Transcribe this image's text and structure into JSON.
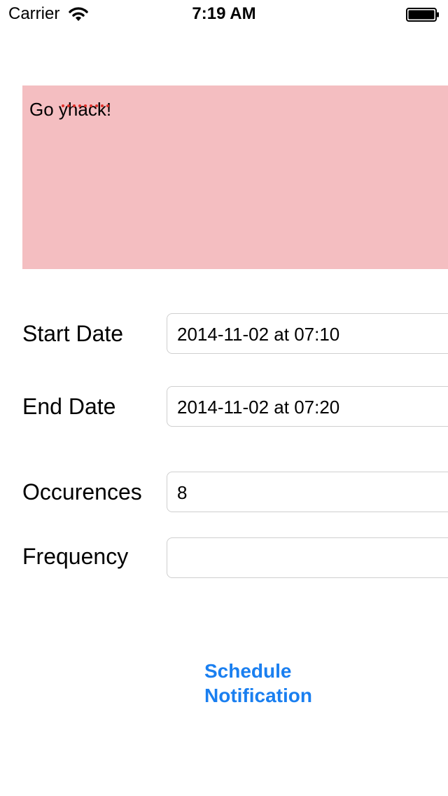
{
  "status_bar": {
    "carrier": "Carrier",
    "time": "7:19 AM",
    "icons": [
      "wifi-icon",
      "battery-icon"
    ]
  },
  "message": {
    "text": "Go yhack!",
    "background_color": "#f4bec1"
  },
  "form": {
    "start_date": {
      "label": "Start Date",
      "value": "2014-11-02 at 07:10"
    },
    "end_date": {
      "label": "End Date",
      "value": "2014-11-02 at 07:20"
    },
    "occurences": {
      "label": "Occurences",
      "value": "8"
    },
    "frequency": {
      "label": "Frequency",
      "value": ""
    }
  },
  "actions": {
    "schedule_line1": "Schedule",
    "schedule_line2": "Notification",
    "accent_color": "#1a7ff0"
  }
}
